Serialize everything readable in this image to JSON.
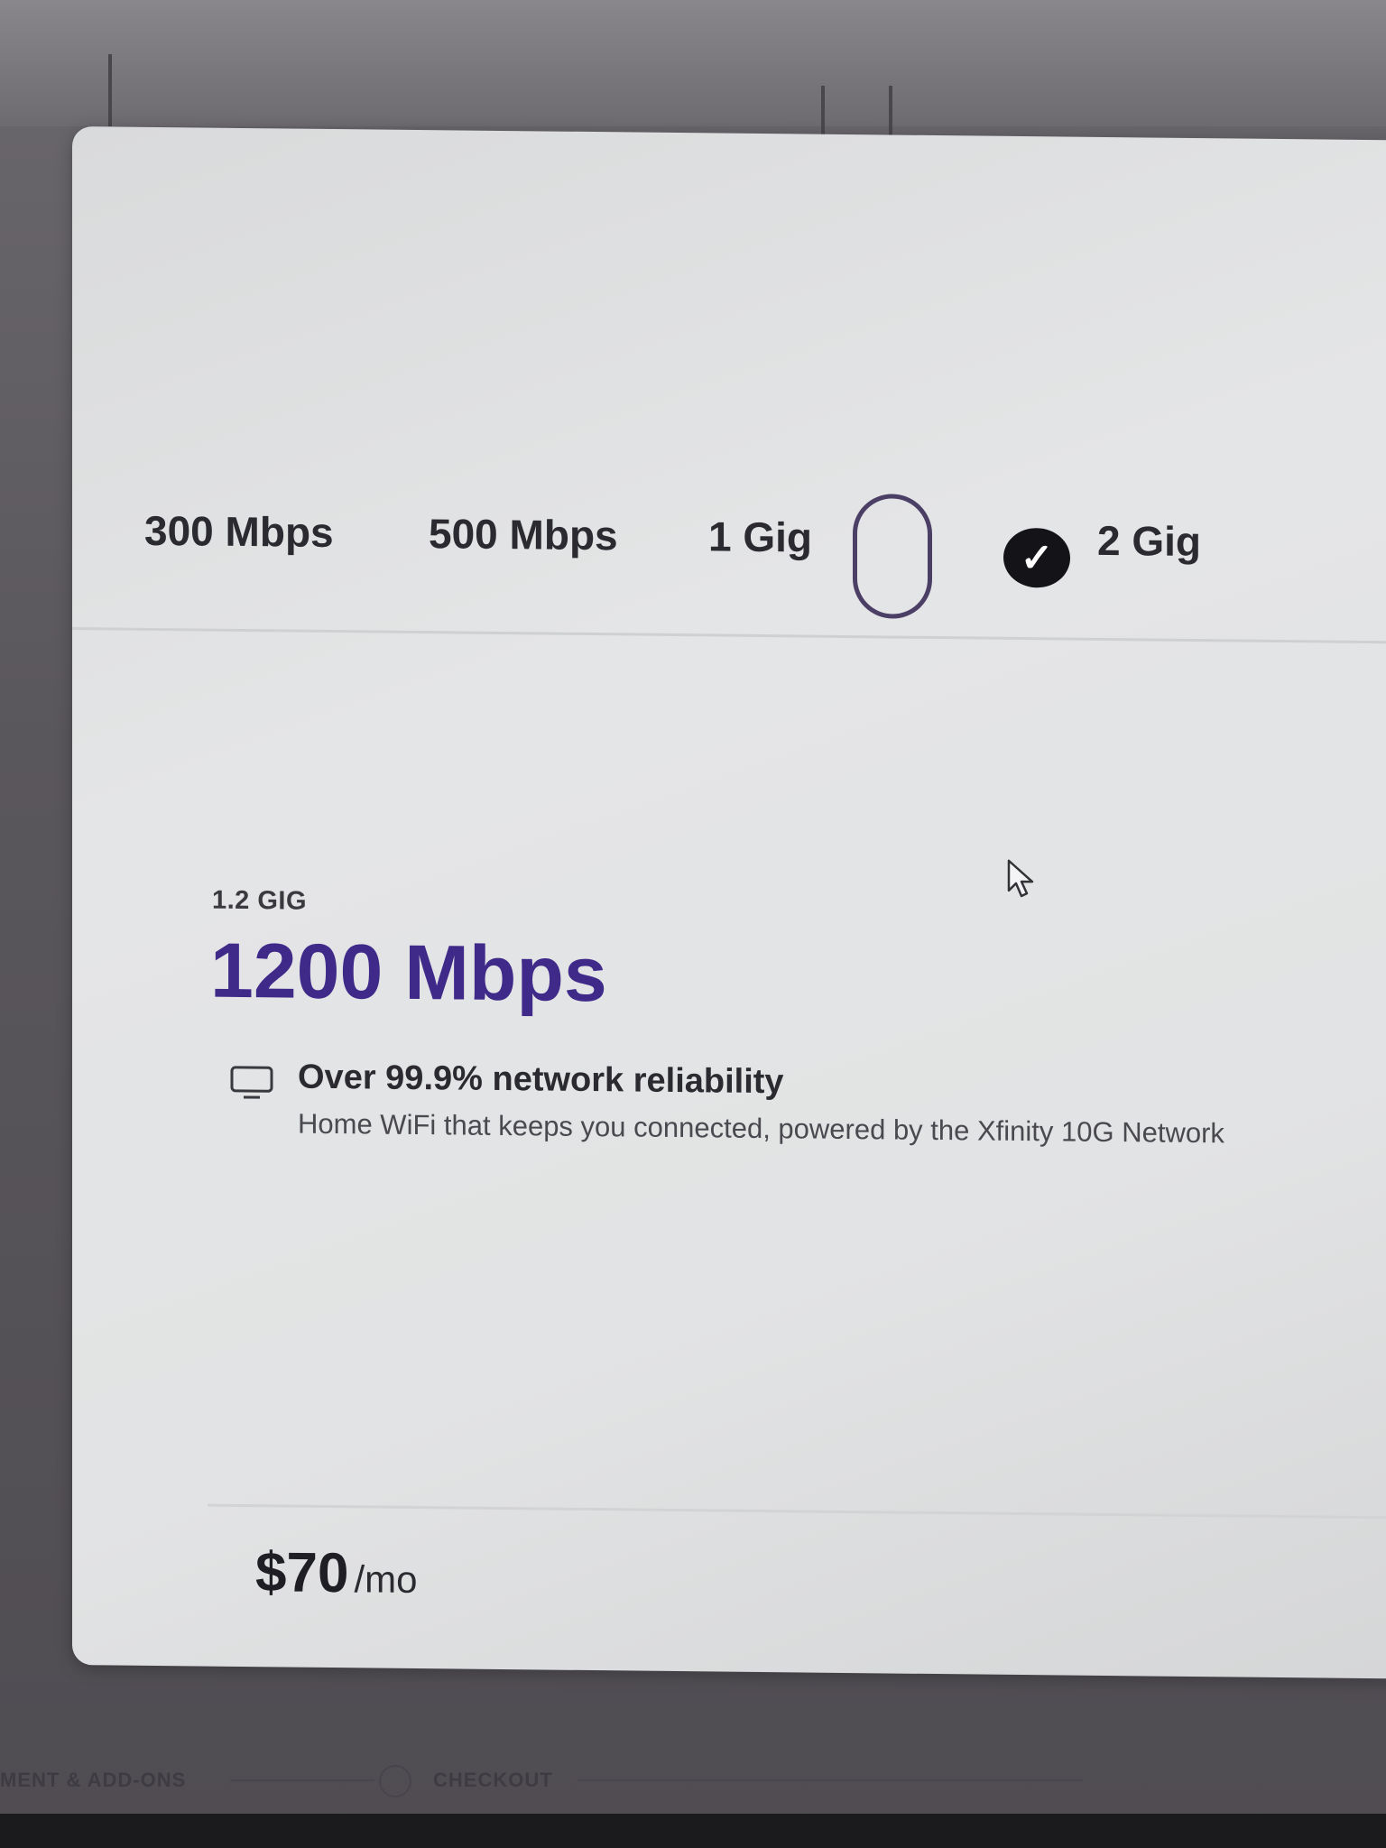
{
  "tiers": {
    "t300": "300 Mbps",
    "t500": "500 Mbps",
    "t1gig": "1 Gig",
    "t2gig": "2 Gig",
    "check_glyph": "✓"
  },
  "plan": {
    "eyebrow": "1.2 GIG",
    "speed": "1200 Mbps"
  },
  "feature": {
    "icon": "monitor-icon",
    "title": "Over 99.9% network reliability",
    "description": "Home WiFi that keeps you connected, powered by the Xfinity 10G Network"
  },
  "price": {
    "amount": "$70",
    "unit": "/mo"
  },
  "stepper": {
    "step_prev": "MENT & ADD-ONS",
    "step_checkout": "CHECKOUT"
  },
  "colors": {
    "accent": "#3f2a8a",
    "toggle_border": "#4b3f66",
    "check_badge": "#141318"
  }
}
